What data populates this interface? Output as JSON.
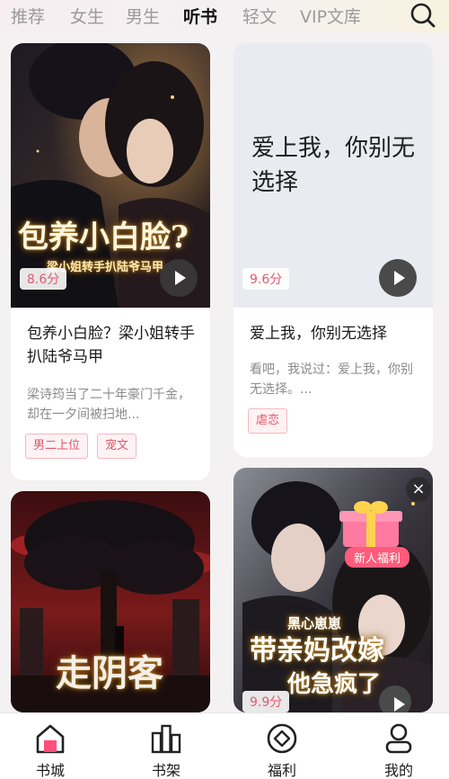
{
  "tabs": [
    {
      "label": "推荐",
      "active": false
    },
    {
      "label": "女生",
      "active": false
    },
    {
      "label": "男生",
      "active": false
    },
    {
      "label": "听书",
      "active": true
    },
    {
      "label": "轻文",
      "active": false
    },
    {
      "label": "VIP文库",
      "active": false
    }
  ],
  "search_icon": "search-icon",
  "cards": [
    {
      "cover_art_title": "包养小白脸?",
      "cover_art_sub": "梁小姐转手扒陆爷马甲",
      "score": "8.6分",
      "title": "包养小白脸？梁小姐转手扒陆爷马甲",
      "desc": "梁诗筠当了二十年豪门千金，却在一夕间被扫地...",
      "tags": [
        "男二上位",
        "宠文"
      ]
    },
    {
      "cover_text": "爱上我，你别无选择",
      "score": "9.6分",
      "title": "爱上我，你别无选择",
      "desc": "看吧，我说过：爱上我，你别无选择。...",
      "tags": [
        "虐恋"
      ]
    },
    {
      "cover_art_title": "走阴客"
    },
    {
      "cover_art_top": "黑心崽崽",
      "cover_art_title": "带亲妈改嫁",
      "cover_art_sub": "他急疯了",
      "score": "9.9分",
      "badge": "新人福利",
      "close_label": "×"
    }
  ],
  "bottom_nav": [
    {
      "label": "书城",
      "icon": "home-icon",
      "active": true
    },
    {
      "label": "书架",
      "icon": "bookshelf-icon",
      "active": false
    },
    {
      "label": "福利",
      "icon": "diamond-coin-icon",
      "active": false
    },
    {
      "label": "我的",
      "icon": "person-icon",
      "active": false
    }
  ],
  "colors": {
    "accent": "#e6596f",
    "tag_text": "#e0566a",
    "badge": "#ff5b7a"
  }
}
